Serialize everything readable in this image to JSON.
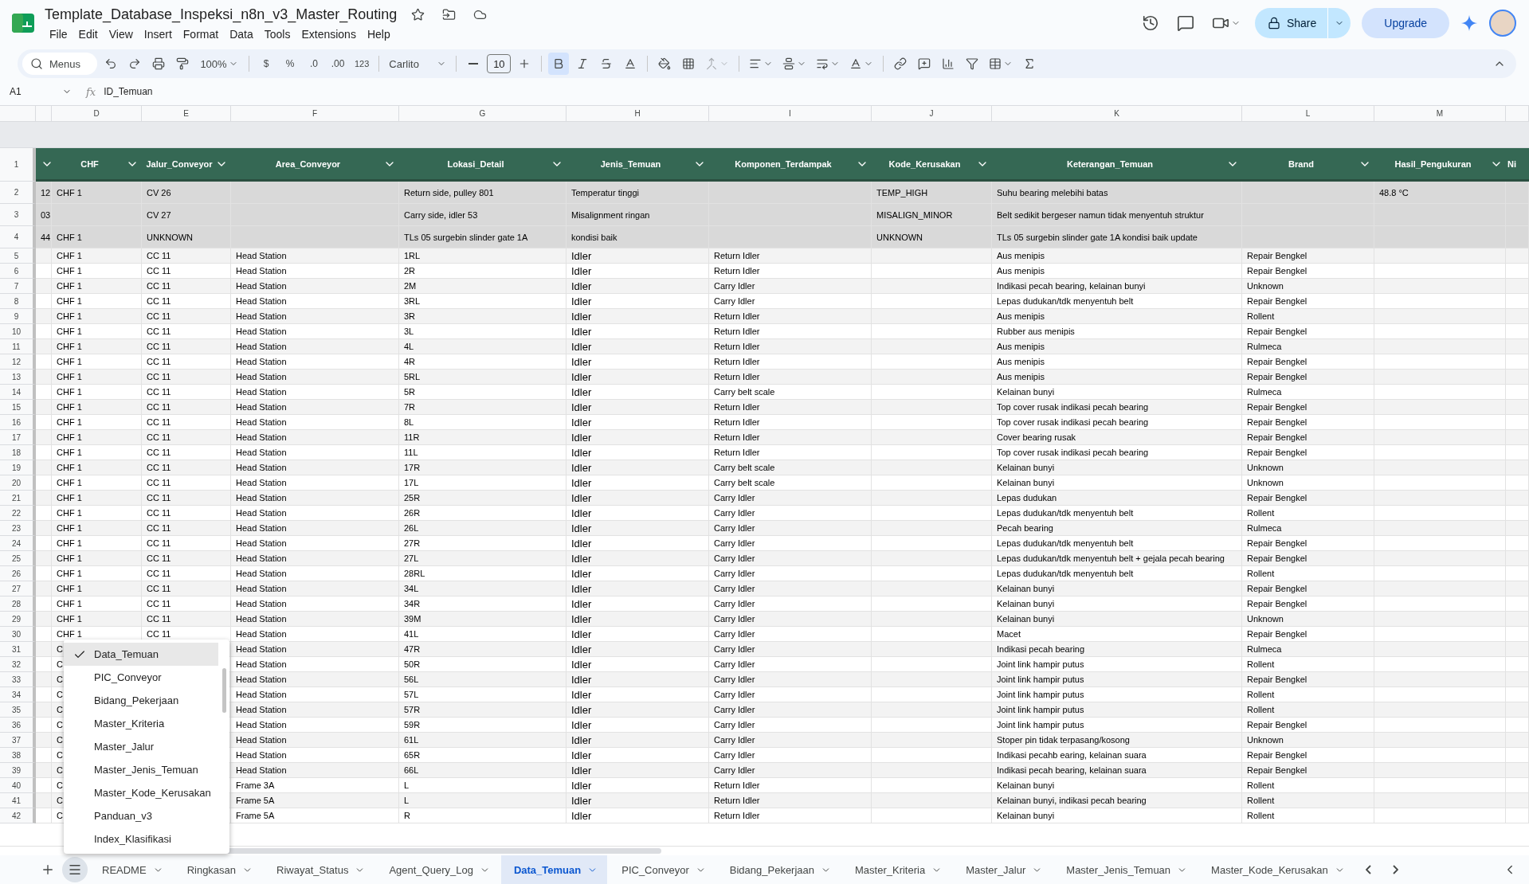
{
  "document": {
    "title": "Template_Database_Inspeksi_n8n_v3_Master_Routing"
  },
  "menu_bar": [
    "File",
    "Edit",
    "View",
    "Insert",
    "Format",
    "Data",
    "Tools",
    "Extensions",
    "Help"
  ],
  "header_actions": {
    "share": "Share",
    "upgrade": "Upgrade"
  },
  "toolbar": {
    "search_placeholder": "Menus",
    "zoom": "100%",
    "currency": "$",
    "percent": "%",
    "decrease_decimals": ".0",
    "increase_decimals": ".00",
    "more_formats": "123",
    "font": "Carlito",
    "font_size": "10",
    "bold": true
  },
  "formula_bar": {
    "cell_ref": "A1",
    "fx_label": "fx",
    "formula": "ID_Temuan"
  },
  "columns": [
    {
      "filter": true
    },
    {
      "letter": "D",
      "heading": "CHF",
      "filter": true
    },
    {
      "letter": "E",
      "heading": "Jalur_Conveyor",
      "filter": true
    },
    {
      "letter": "F",
      "heading": "Area_Conveyor",
      "filter": true
    },
    {
      "letter": "G",
      "heading": "Lokasi_Detail",
      "filter": true
    },
    {
      "letter": "H",
      "heading": "Jenis_Temuan",
      "filter": true
    },
    {
      "letter": "I",
      "heading": "Komponen_Terdampak",
      "filter": true
    },
    {
      "letter": "J",
      "heading": "Kode_Kerusakan",
      "filter": true
    },
    {
      "letter": "K",
      "heading": "Keterangan_Temuan",
      "filter": true
    },
    {
      "letter": "L",
      "heading": "Brand",
      "filter": true
    },
    {
      "letter": "M",
      "heading": "Hasil_Pengukuran",
      "filter": true
    },
    {
      "heading": "Ni",
      "filter": false
    }
  ],
  "header_row_number": "1",
  "rows": [
    {
      "number": "2",
      "shaded": true,
      "cells": {
        "C": "12",
        "D": "CHF 1",
        "E": "CV 26",
        "G": "Return side, pulley 801",
        "H": "Temperatur tinggi",
        "J": "TEMP_HIGH",
        "K": "Suhu bearing melebihi batas",
        "M": "48.8 °C"
      }
    },
    {
      "number": "3",
      "shaded": true,
      "cells": {
        "C": "03",
        "E": "CV 27",
        "G": "Carry side, idler 53",
        "H": "Misalignment ringan",
        "J": "MISALIGN_MINOR",
        "K": "Belt sedikit bergeser namun tidak menyentuh struktur"
      }
    },
    {
      "number": "4",
      "shaded": true,
      "cells": {
        "C": "44",
        "D": "CHF 1",
        "E": "UNKNOWN",
        "G": "TLs 05 surgebin slinder gate 1A",
        "H": "kondisi baik",
        "J": "UNKNOWN",
        "K": "TLs 05 surgebin slinder gate 1A kondisi baik update"
      }
    },
    {
      "number": "5",
      "shaded": false,
      "cells": {
        "D": "CHF 1",
        "E": "CC 11",
        "F": "Head Station",
        "G": "1RL",
        "H": "Idler",
        "I": "Return Idler",
        "K": "Aus menipis",
        "L": "Repair Bengkel"
      }
    },
    {
      "number": "6",
      "shaded": false,
      "cells": {
        "D": "CHF 1",
        "E": "CC 11",
        "F": "Head Station",
        "G": "2R",
        "H": "Idler",
        "I": "Return Idler",
        "K": "Aus menipis",
        "L": "Repair Bengkel"
      }
    },
    {
      "number": "7",
      "shaded": false,
      "cells": {
        "D": "CHF 1",
        "E": "CC 11",
        "F": "Head Station",
        "G": "2M",
        "H": "Idler",
        "I": "Carry Idler",
        "K": "Indikasi pecah bearing, kelainan bunyi",
        "L": "Unknown"
      }
    },
    {
      "number": "8",
      "shaded": false,
      "cells": {
        "D": "CHF 1",
        "E": "CC 11",
        "F": "Head Station",
        "G": "3RL",
        "H": "Idler",
        "I": "Carry Idler",
        "K": "Lepas dudukan/tdk menyentuh belt",
        "L": "Repair Bengkel"
      }
    },
    {
      "number": "9",
      "shaded": false,
      "cells": {
        "D": "CHF 1",
        "E": "CC 11",
        "F": "Head Station",
        "G": "3R",
        "H": "Idler",
        "I": "Return Idler",
        "K": "Aus menipis",
        "L": "Rollent"
      }
    },
    {
      "number": "10",
      "shaded": false,
      "cells": {
        "D": "CHF 1",
        "E": "CC 11",
        "F": "Head Station",
        "G": "3L",
        "H": "Idler",
        "I": "Return Idler",
        "K": "Rubber aus menipis",
        "L": "Repair Bengkel"
      }
    },
    {
      "number": "11",
      "shaded": false,
      "cells": {
        "D": "CHF 1",
        "E": "CC 11",
        "F": "Head Station",
        "G": "4L",
        "H": "Idler",
        "I": "Return Idler",
        "K": "Aus menipis",
        "L": "Rulmeca"
      }
    },
    {
      "number": "12",
      "shaded": false,
      "cells": {
        "D": "CHF 1",
        "E": "CC 11",
        "F": "Head Station",
        "G": "4R",
        "H": "Idler",
        "I": "Return Idler",
        "K": "Aus menipis",
        "L": "Repair Bengkel"
      }
    },
    {
      "number": "13",
      "shaded": false,
      "cells": {
        "D": "CHF 1",
        "E": "CC 11",
        "F": "Head Station",
        "G": "5RL",
        "H": "Idler",
        "I": "Return Idler",
        "K": "Aus menipis",
        "L": "Repair Bengkel"
      }
    },
    {
      "number": "14",
      "shaded": false,
      "cells": {
        "D": "CHF 1",
        "E": "CC 11",
        "F": "Head Station",
        "G": "5R",
        "H": "Idler",
        "I": "Carry belt scale",
        "K": "Kelainan bunyi",
        "L": "Rulmeca"
      }
    },
    {
      "number": "15",
      "shaded": false,
      "cells": {
        "D": "CHF 1",
        "E": "CC 11",
        "F": "Head Station",
        "G": "7R",
        "H": "Idler",
        "I": "Return Idler",
        "K": "Top cover rusak indikasi pecah bearing",
        "L": "Repair Bengkel"
      }
    },
    {
      "number": "16",
      "shaded": false,
      "cells": {
        "D": "CHF 1",
        "E": "CC 11",
        "F": "Head Station",
        "G": "8L",
        "H": "Idler",
        "I": "Return Idler",
        "K": "Top cover rusak indikasi pecah bearing",
        "L": "Repair Bengkel"
      }
    },
    {
      "number": "17",
      "shaded": false,
      "cells": {
        "D": "CHF 1",
        "E": "CC 11",
        "F": "Head Station",
        "G": "11R",
        "H": "Idler",
        "I": "Return Idler",
        "K": "Cover bearing rusak",
        "L": "Repair Bengkel"
      }
    },
    {
      "number": "18",
      "shaded": false,
      "cells": {
        "D": "CHF 1",
        "E": "CC 11",
        "F": "Head Station",
        "G": "11L",
        "H": "Idler",
        "I": "Return Idler",
        "K": "Top cover rusak indikasi pecah bearing",
        "L": "Repair Bengkel"
      }
    },
    {
      "number": "19",
      "shaded": false,
      "cells": {
        "D": "CHF 1",
        "E": "CC 11",
        "F": "Head Station",
        "G": "17R",
        "H": "Idler",
        "I": "Carry belt scale",
        "K": "Kelainan bunyi",
        "L": "Unknown"
      }
    },
    {
      "number": "20",
      "shaded": false,
      "cells": {
        "D": "CHF 1",
        "E": "CC 11",
        "F": "Head Station",
        "G": "17L",
        "H": "Idler",
        "I": "Carry belt scale",
        "K": "Kelainan bunyi",
        "L": "Unknown"
      }
    },
    {
      "number": "21",
      "shaded": false,
      "cells": {
        "D": "CHF 1",
        "E": "CC 11",
        "F": "Head Station",
        "G": "25R",
        "H": "Idler",
        "I": "Carry Idler",
        "K": "Lepas dudukan",
        "L": "Repair Bengkel"
      }
    },
    {
      "number": "22",
      "shaded": false,
      "cells": {
        "D": "CHF 1",
        "E": "CC 11",
        "F": "Head Station",
        "G": "26R",
        "H": "Idler",
        "I": "Carry Idler",
        "K": "Lepas dudukan/tdk menyentuh belt",
        "L": "Rollent"
      }
    },
    {
      "number": "23",
      "shaded": false,
      "cells": {
        "D": "CHF 1",
        "E": "CC 11",
        "F": "Head Station",
        "G": "26L",
        "H": "Idler",
        "I": "Carry Idler",
        "K": "Pecah bearing",
        "L": "Rulmeca"
      }
    },
    {
      "number": "24",
      "shaded": false,
      "cells": {
        "D": "CHF 1",
        "E": "CC 11",
        "F": "Head Station",
        "G": "27R",
        "H": "Idler",
        "I": "Carry Idler",
        "K": "Lepas dudukan/tdk menyentuh belt",
        "L": "Repair Bengkel"
      }
    },
    {
      "number": "25",
      "shaded": false,
      "cells": {
        "D": "CHF 1",
        "E": "CC 11",
        "F": "Head Station",
        "G": "27L",
        "H": "Idler",
        "I": "Carry Idler",
        "K": "Lepas dudukan/tdk menyentuh belt + gejala pecah bearing",
        "L": "Repair Bengkel"
      }
    },
    {
      "number": "26",
      "shaded": false,
      "cells": {
        "D": "CHF 1",
        "E": "CC 11",
        "F": "Head Station",
        "G": "28RL",
        "H": "Idler",
        "I": "Carry Idler",
        "K": "Lepas dudukan/tdk menyentuh belt",
        "L": "Rollent"
      }
    },
    {
      "number": "27",
      "shaded": false,
      "cells": {
        "D": "CHF 1",
        "E": "CC 11",
        "F": "Head Station",
        "G": "34L",
        "H": "Idler",
        "I": "Carry Idler",
        "K": "Kelainan bunyi",
        "L": "Repair Bengkel"
      }
    },
    {
      "number": "28",
      "shaded": false,
      "cells": {
        "D": "CHF 1",
        "E": "CC 11",
        "F": "Head Station",
        "G": "34R",
        "H": "Idler",
        "I": "Carry Idler",
        "K": "Kelainan bunyi",
        "L": "Repair Bengkel"
      }
    },
    {
      "number": "29",
      "shaded": false,
      "cells": {
        "D": "CHF 1",
        "E": "CC 11",
        "F": "Head Station",
        "G": "39M",
        "H": "Idler",
        "I": "Carry Idler",
        "K": "Kelainan bunyi",
        "L": "Unknown"
      }
    },
    {
      "number": "30",
      "shaded": false,
      "cells": {
        "D": "CHF 1",
        "E": "CC 11",
        "F": "Head Station",
        "G": "41L",
        "H": "Idler",
        "I": "Carry Idler",
        "K": "Macet",
        "L": "Repair Bengkel"
      }
    },
    {
      "number": "31",
      "shaded": false,
      "cells": {
        "D": "C",
        "F": "Head Station",
        "G": "47R",
        "H": "Idler",
        "I": "Carry Idler",
        "K": "Indikasi pecah bearing",
        "L": "Rulmeca"
      }
    },
    {
      "number": "32",
      "shaded": false,
      "cells": {
        "D": "C",
        "F": "Head Station",
        "G": "50R",
        "H": "Idler",
        "I": "Carry Idler",
        "K": "Joint link hampir putus",
        "L": "Rollent"
      }
    },
    {
      "number": "33",
      "shaded": false,
      "cells": {
        "D": "C",
        "F": "Head Station",
        "G": "56L",
        "H": "Idler",
        "I": "Carry Idler",
        "K": "Joint link hampir putus",
        "L": "Repair Bengkel"
      }
    },
    {
      "number": "34",
      "shaded": false,
      "cells": {
        "D": "C",
        "F": "Head Station",
        "G": "57L",
        "H": "Idler",
        "I": "Carry Idler",
        "K": "Joint link hampir putus",
        "L": "Rollent"
      }
    },
    {
      "number": "35",
      "shaded": false,
      "cells": {
        "D": "C",
        "F": "Head Station",
        "G": "57R",
        "H": "Idler",
        "I": "Carry Idler",
        "K": "Joint link hampir putus",
        "L": "Rollent"
      }
    },
    {
      "number": "36",
      "shaded": false,
      "cells": {
        "D": "C",
        "F": "Head Station",
        "G": "59R",
        "H": "Idler",
        "I": "Carry Idler",
        "K": "Joint link hampir putus",
        "L": "Repair Bengkel"
      }
    },
    {
      "number": "37",
      "shaded": false,
      "cells": {
        "D": "C",
        "F": "Head Station",
        "G": "61L",
        "H": "Idler",
        "I": "Carry Idler",
        "K": "Stoper pin tidak terpasang/kosong",
        "L": "Unknown"
      }
    },
    {
      "number": "38",
      "shaded": false,
      "cells": {
        "D": "C",
        "F": "Head Station",
        "G": "65R",
        "H": "Idler",
        "I": "Carry Idler",
        "K": "Indikasi pecahb earing, kelainan suara",
        "L": "Repair Bengkel"
      }
    },
    {
      "number": "39",
      "shaded": false,
      "cells": {
        "D": "C",
        "F": "Head Station",
        "G": "66L",
        "H": "Idler",
        "I": "Carry Idler",
        "K": "Indikasi pecah bearing, kelainan suara",
        "L": "Repair Bengkel"
      }
    },
    {
      "number": "40",
      "shaded": false,
      "cells": {
        "D": "C",
        "F": "Frame 3A",
        "G": "L",
        "H": "Idler",
        "I": "Return Idler",
        "K": "Kelainan bunyi",
        "L": "Rollent"
      }
    },
    {
      "number": "41",
      "shaded": false,
      "cells": {
        "D": "C",
        "F": "Frame 5A",
        "G": "L",
        "H": "Idler",
        "I": "Return Idler",
        "K": "Kelainan bunyi, indikasi pecah bearing",
        "L": "Rollent"
      }
    },
    {
      "number": "42",
      "shaded": false,
      "cells": {
        "D": "C",
        "F": "Frame 5A",
        "G": "R",
        "H": "Idler",
        "I": "Return Idler",
        "K": "Kelainan bunyi",
        "L": "Rollent"
      }
    }
  ],
  "sheet_menu": [
    {
      "label": "Data_Temuan",
      "selected": true
    },
    {
      "label": "PIC_Conveyor",
      "selected": false
    },
    {
      "label": "Bidang_Pekerjaan",
      "selected": false
    },
    {
      "label": "Master_Kriteria",
      "selected": false
    },
    {
      "label": "Master_Jalur",
      "selected": false
    },
    {
      "label": "Master_Jenis_Temuan",
      "selected": false
    },
    {
      "label": "Master_Kode_Kerusakan",
      "selected": false
    },
    {
      "label": "Panduan_v3",
      "selected": false
    },
    {
      "label": "Index_Klasifikasi",
      "selected": false
    }
  ],
  "sheet_tabs": [
    {
      "label": "README",
      "selected": false
    },
    {
      "label": "Ringkasan",
      "selected": false
    },
    {
      "label": "Riwayat_Status",
      "selected": false
    },
    {
      "label": "Agent_Query_Log",
      "selected": false
    },
    {
      "label": "Data_Temuan",
      "selected": true
    },
    {
      "label": "PIC_Conveyor",
      "selected": false
    },
    {
      "label": "Bidang_Pekerjaan",
      "selected": false
    },
    {
      "label": "Master_Kriteria",
      "selected": false
    },
    {
      "label": "Master_Jalur",
      "selected": false
    },
    {
      "label": "Master_Jenis_Temuan",
      "selected": false
    },
    {
      "label": "Master_Kode_Kerusakan",
      "selected": false
    }
  ]
}
